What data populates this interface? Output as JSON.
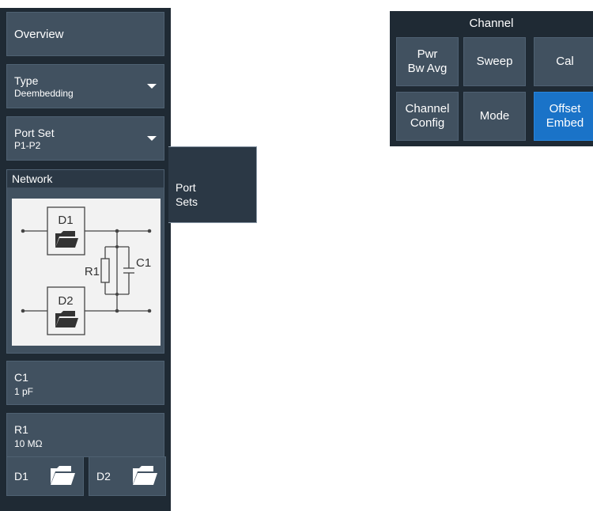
{
  "left_panel": {
    "overview_label": "Overview",
    "type": {
      "label": "Type",
      "value": "Deembedding"
    },
    "port_set": {
      "label": "Port Set",
      "value": "P1-P2"
    },
    "network": {
      "header": "Network",
      "schematic": {
        "d1": "D1",
        "d2": "D2",
        "r1": "R1",
        "c1": "C1"
      }
    },
    "c1": {
      "label": "C1",
      "value": "1 pF"
    },
    "r1": {
      "label": "R1",
      "value": "10 MΩ"
    },
    "d1_label": "D1",
    "d2_label": "D2"
  },
  "port_sets_button": {
    "label": "Port\nSets"
  },
  "channel_panel": {
    "title": "Channel",
    "buttons": [
      {
        "label": "Pwr\nBw Avg",
        "active": false
      },
      {
        "label": "Sweep",
        "active": false
      },
      {
        "label": "Cal",
        "active": false
      },
      {
        "label": "Channel\nConfig",
        "active": false
      },
      {
        "label": "Mode",
        "active": false
      },
      {
        "label": "Offset\nEmbed",
        "active": true
      }
    ]
  },
  "colors": {
    "panel_bg": "#1f2a34",
    "button_bg": "#415160",
    "active_accent": "#1a73c8"
  }
}
